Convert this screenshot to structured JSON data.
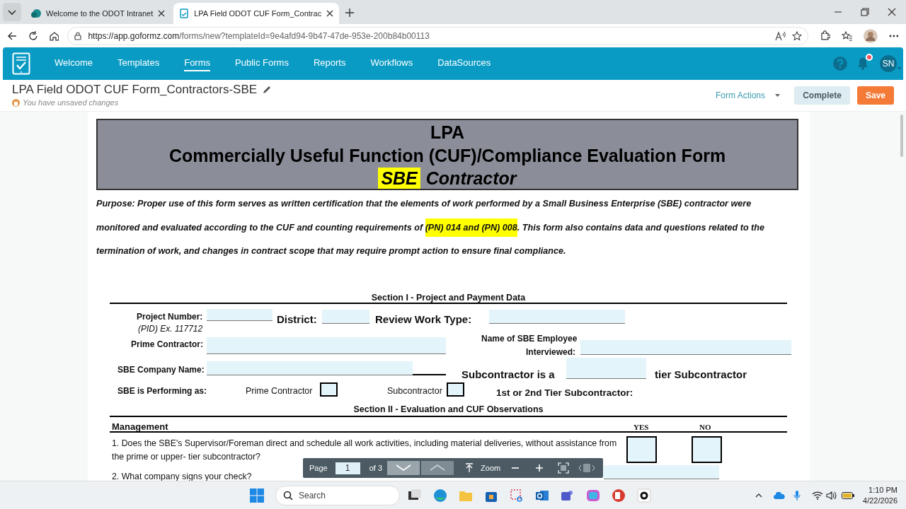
{
  "browser": {
    "tabs": [
      {
        "title": "Welcome to the ODOT Intranet",
        "selected": false
      },
      {
        "title": "LPA Field ODOT CUF Form_Contrac",
        "selected": true
      }
    ],
    "url_host": "https://app.goformz.com",
    "url_path": "/forms/new?templateId=9e4afd94-9b47-47de-953e-200b84b00113"
  },
  "app": {
    "nav": [
      {
        "label": "Welcome",
        "selected": false
      },
      {
        "label": "Templates",
        "selected": false
      },
      {
        "label": "Forms",
        "selected": true
      },
      {
        "label": "Public Forms",
        "selected": false
      },
      {
        "label": "Reports",
        "selected": false
      },
      {
        "label": "Workflows",
        "selected": false
      },
      {
        "label": "DataSources",
        "selected": false
      }
    ],
    "has_notification": true,
    "user_initials": "SN"
  },
  "form_header": {
    "title": "LPA Field ODOT CUF Form_Contractors-SBE",
    "status": "You have unsaved changes",
    "actions_menu": "Form Actions",
    "buttons": [
      {
        "label": "Complete",
        "kind": "secondary"
      },
      {
        "label": "Save",
        "kind": "primary"
      }
    ]
  },
  "document": {
    "banner": {
      "line_1": "LPA",
      "line_2": "Commercially Useful Function (CUF)/Compliance Evaluation Form",
      "highlight": "SBE",
      "line_3": "Contractor"
    },
    "purpose": [
      {
        "text": "Purpose: Proper use of this form serves as written certification that the elements of work performed by a Small Business Enterprise (SBE) contractor were monitored and evaluated according to the CUF and counting requirements of ",
        "highlighted": false
      },
      {
        "text": "(PN) 014 and (PN) 008",
        "highlighted": true
      },
      {
        "text": ". This form also contains data and questions related to the termination of work, and changes in contract scope that may require prompt action to ensure final compliance.",
        "highlighted": false
      }
    ],
    "section_1": {
      "title": "Section I - Project and Payment Data",
      "project_number": "Project Number:",
      "project_hint": "(PID) Ex. 117712",
      "district": "District:",
      "review_work_type": "Review Work Type:",
      "prime_contractor": "Prime Contractor:",
      "employee_name_1": "Name of SBE Employee",
      "employee_name_2": "Interviewed:",
      "company_name": "SBE Company Name:",
      "subcontractor_is": "Subcontractor is a",
      "tier_suffix": "tier Subcontractor",
      "performing_as": "SBE is Performing as:",
      "options": [
        {
          "label": "Prime Contractor",
          "checked": false
        },
        {
          "label": "Subcontractor",
          "checked": false
        }
      ],
      "tier_label": "1st or 2nd Tier Subcontractor:"
    },
    "section_2": {
      "title": "Section II - Evaluation and CUF Observations",
      "group": "Management",
      "yes": "YES",
      "no": "NO",
      "questions": [
        {
          "text": "1.  Does the SBE's Supervisor/Foreman direct and schedule all work activities, including material deliveries, without assistance from the prime or upper- tier subcontractor?",
          "yes": false,
          "no": false
        },
        {
          "text": "2.  What company signs your check?"
        }
      ]
    }
  },
  "pager": {
    "page_label": "Page",
    "page": "1",
    "of": "of 3",
    "zoom_label": "Zoom"
  },
  "taskbar": {
    "search": "Search",
    "time": "1:10 PM",
    "date": "4/22/2026"
  }
}
